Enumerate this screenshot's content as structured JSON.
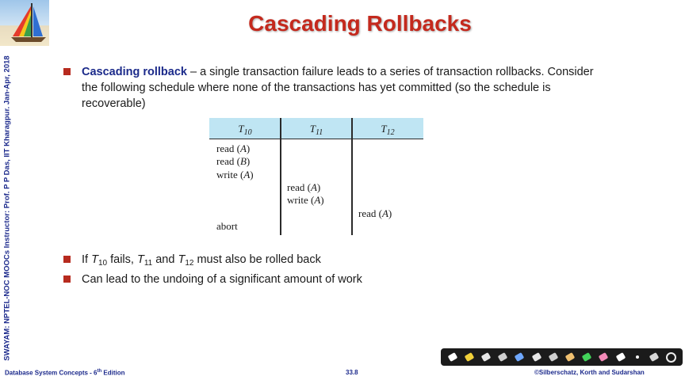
{
  "slide": {
    "title": "Cascading Rollbacks",
    "sidebar_text": "SWAYAM: NPTEL-NOC MOOCs Instructor: Prof. P P Das, IIT Kharagpur. Jan-Apr, 2018",
    "bullets": [
      {
        "term": "Cascading rollback",
        "text": " – a single transaction failure leads to a series of transaction rollbacks. Consider the following schedule where none of the transactions has yet committed (so the schedule is recoverable)"
      },
      {
        "parts": [
          "If ",
          "T",
          "10",
          " fails, ",
          "T",
          "11",
          " and ",
          "T",
          "12",
          " must also be rolled back"
        ]
      },
      {
        "text": "Can lead to the undoing of a significant amount of work"
      }
    ],
    "schedule": {
      "headers": [
        {
          "base": "T",
          "sub": "10"
        },
        {
          "base": "T",
          "sub": "11"
        },
        {
          "base": "T",
          "sub": "12"
        }
      ],
      "ops": [
        {
          "col": 0,
          "op": "read",
          "item": "A"
        },
        {
          "col": 0,
          "op": "read",
          "item": "B"
        },
        {
          "col": 0,
          "op": "write",
          "item": "A"
        },
        {
          "col": 1,
          "op": "read",
          "item": "A"
        },
        {
          "col": 1,
          "op": "write",
          "item": "A"
        },
        {
          "col": 2,
          "op": "read",
          "item": "A"
        },
        {
          "col": 0,
          "op": "abort",
          "item": ""
        }
      ]
    },
    "footer": {
      "book": "Database System Concepts - 6",
      "book_sup": "th",
      "book_suffix": " Edition",
      "page": "33.8",
      "copyright": "©Silberschatz, Korth and Sudarshan"
    },
    "toolbar_icons": [
      "pointer-icon",
      "pen-icon",
      "eraser-icon",
      "grid-icon",
      "marker-icon",
      "highlighter-icon",
      "screen-icon",
      "pencil-icon",
      "green-marker-icon",
      "pink-marker-icon",
      "laser-icon",
      "dot-icon",
      "keyboard-icon",
      "close-icon"
    ]
  }
}
